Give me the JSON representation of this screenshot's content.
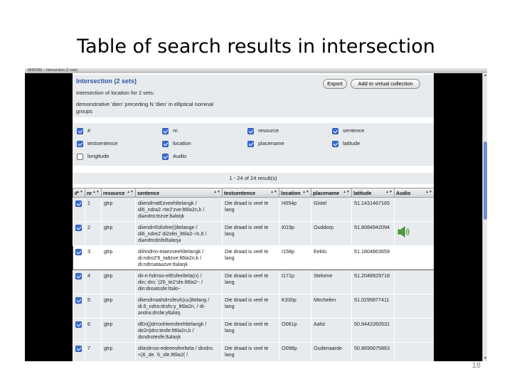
{
  "slide": {
    "title": "Table of search results in intersection",
    "page_number": "18"
  },
  "window": {
    "title": "MIMORE – Intersection (2 sets)"
  },
  "intersection": {
    "title": "Intersection (2 sets)",
    "description": "Intersection of location for 2 sets:",
    "sets": "demonstrative 'dien' preceding N 'dien' in elliptical nominal groups",
    "export_label": "Export",
    "add_label": "Add to virtual collection"
  },
  "columns_options": [
    {
      "label": "#",
      "checked": true
    },
    {
      "label": "nr.",
      "checked": true
    },
    {
      "label": "resource",
      "checked": true
    },
    {
      "label": "sentence",
      "checked": true
    },
    {
      "label": "testsentence",
      "checked": true
    },
    {
      "label": "location",
      "checked": true
    },
    {
      "label": "placename",
      "checked": true
    },
    {
      "label": "latitude",
      "checked": true
    },
    {
      "label": "longitude",
      "checked": false
    },
    {
      "label": "Audio",
      "checked": true
    }
  ],
  "results_summary": "1 - 24 of 24 result(s)",
  "table": {
    "headers": [
      "#",
      "nr",
      "resource",
      "sentence",
      "testsentence",
      "location",
      "placename",
      "latitude",
      "Audio"
    ],
    "rows": [
      {
        "nr": "1",
        "resource": "gtrp",
        "sentence": "diiendrratEzveehltelangk / di6_ndra2.<te2'zve:lt6la2n,k / diəndrɑ:tɛzve:ltəlɑŋk",
        "testsentence": "Die draad is veel te lang",
        "location": "H054p",
        "placename": "Gistel",
        "latitude": "51.1431467165",
        "audio": false
      },
      {
        "nr": "2",
        "resource": "gtrp",
        "sentence": "diiendrrEdisfee(i)ltelange / di6_ndre2`di2sfei_lt6la2~/n,6 / diəndrɛdisfɛiltəlɑŋə",
        "testsentence": "Die draad is veel te lang",
        "location": "I019p",
        "placename": "Ouddorp",
        "latitude": "51.8084942094",
        "audio": true
      },
      {
        "nr": "3",
        "resource": "gtrp",
        "sentence": "diihndrro-etaezveehltelangk / di:ndro2'6_ta8zve:lt6la2n,k / di:ndroətaəzve:ltəlaŋk",
        "testsentence": "Die draad is veel te lang",
        "location": "I158p",
        "placename": "Eeklo",
        "latitude": "51.1804863659",
        "audio": false
      },
      {
        "nr": "4",
        "resource": "gtrp",
        "sentence": "dii-n-hdrroo-etEsfeeltela(n) / din;:dro.`(26_te2'sfe.lt6la2~ / din:droətɛsfe:ltəlɑ~",
        "testsentence": "Die draad is veel te lang",
        "location": "I171p",
        "placename": "Stekene",
        "latitude": "51.2048929718",
        "audio": false
      },
      {
        "nr": "5",
        "resource": "gtrp",
        "sentence": "diiendrraahdrrsfeuh(uu)ltelang / di.6_ndra:drsfo:y_lt6la2n, / di-əndra:drsfø:yltəlɑŋ",
        "testsentence": "Die draad is veel te lang",
        "location": "K330p",
        "placename": "Mechelen",
        "latitude": "51.0295877411",
        "audio": false
      },
      {
        "nr": "6",
        "resource": "gtrp",
        "sentence": "dEn(j)drroohteesfeehltelangk / de2n|dro:tesfe:lt6la2n,k / dɛndrotesfe:ltəlaŋk",
        "testsentence": "Die draad is veel te lang",
        "location": "O061p",
        "placename": "Aalst",
        "latitude": "50.9442260531",
        "audio": false
      },
      {
        "nr": "7",
        "resource": "gtrp",
        "sentence": "diiindrroo-edeeesfeeltela / dindro.<(6_de.`6_sfe.lt6la2( /",
        "testsentence": "Die draad is veel te lang",
        "location": "O098p",
        "placename": "Oudenaarde",
        "latitude": "50.8695675863",
        "audio": false
      }
    ]
  },
  "colors": {
    "accent": "#2f55a3",
    "resource_text": "#c0262c",
    "panel_bg": "#e7ebee",
    "checkbox": "#3a6fd8"
  }
}
